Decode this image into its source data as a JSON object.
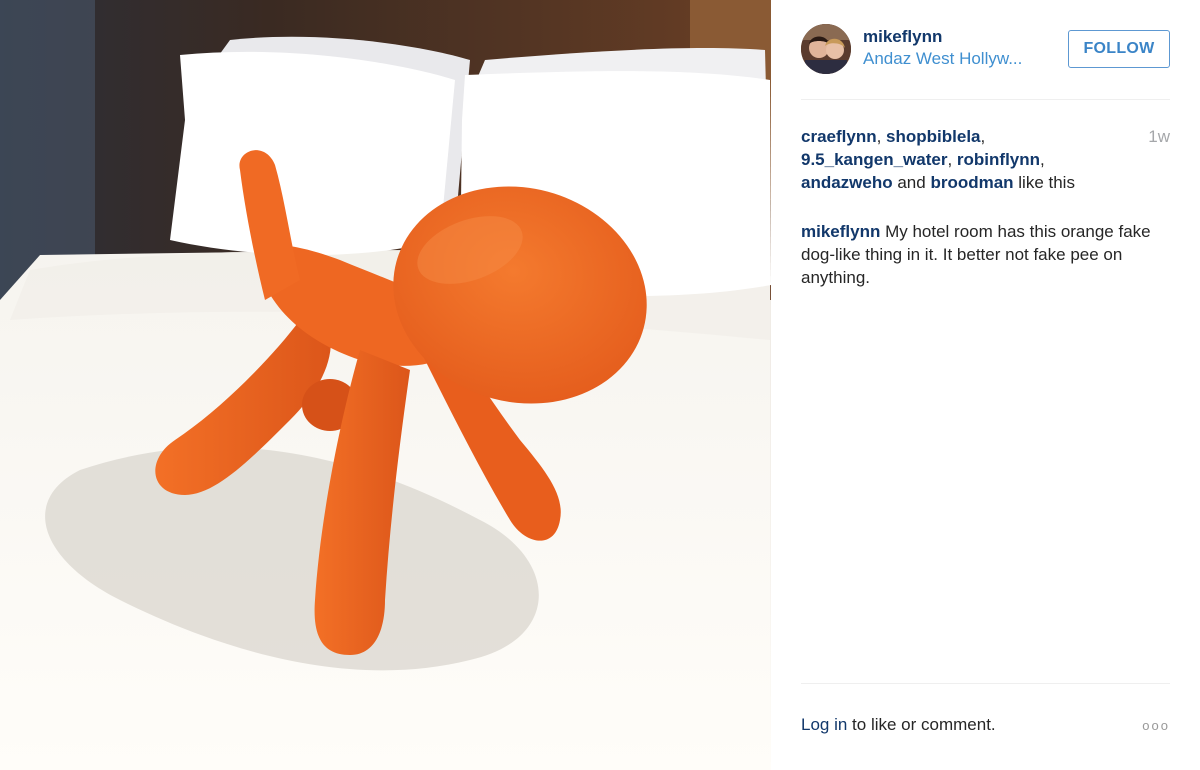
{
  "post": {
    "author": "mikeflynn",
    "location": "Andaz West Hollyw...",
    "follow_label": "FOLLOW",
    "time_ago": "1w",
    "likes": {
      "users": [
        "craeflynn",
        "shopbiblela",
        "9.5_kangen_water",
        "robinflynn",
        "andazweho",
        "broodman"
      ],
      "sep1": ", ",
      "sep2": ", ",
      "sep3": ", ",
      "sep4": ", ",
      "and_text": " and ",
      "suffix": " like this"
    },
    "caption": {
      "author": "mikeflynn",
      "text": " My hotel room has this orange fake dog-like thing in it. It better not fake pee on anything."
    },
    "login": {
      "link": "Log in",
      "suffix": " to like or comment."
    },
    "more_icon": "ooo"
  },
  "photo": {
    "subject": "orange-puppy-sculpture",
    "colors": {
      "dog": "#f26b21",
      "dog_dark": "#d9541a",
      "headboard": "#4a2c1e",
      "sheet": "#fbf8f3",
      "pillow": "#ffffff"
    }
  }
}
